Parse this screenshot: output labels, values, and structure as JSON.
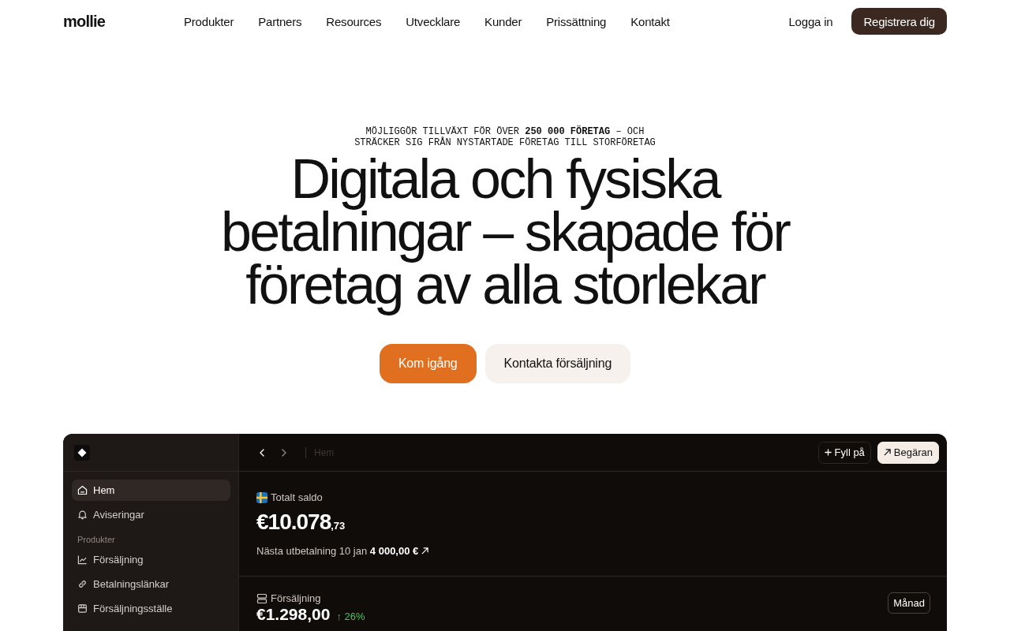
{
  "nav": {
    "logo": "mollie",
    "links": [
      "Produkter",
      "Partners",
      "Resources",
      "Utvecklare",
      "Kunder",
      "Prissättning",
      "Kontakt"
    ],
    "login": "Logga in",
    "signup": "Registrera dig"
  },
  "hero": {
    "eyebrow": "MÖJLIGGÖR TILLVÄXT FÖR ÖVER **250 000 FÖRETAG** – OCH STRÄCKER SIG FRÅN NYSTARTADE FÖRETAG TILL STORFÖRETAG",
    "title": "Digitala och fysiska betalningar – skapade för företag av alla storlekar",
    "buttons": [
      {
        "label": "Kom igång",
        "kind": "primary"
      },
      {
        "label": "Kontakta försäljning",
        "kind": "secondary"
      }
    ]
  },
  "dashboard": {
    "sidebar": {
      "items": [
        {
          "label": "Hem",
          "selected": true
        },
        {
          "label": "Aviseringar",
          "selected": false
        }
      ],
      "sections": [
        {
          "title": "Produkter",
          "items": [
            {
              "label": "Försäljning",
              "selected": false
            },
            {
              "label": "Betalningslänkar",
              "selected": false
            },
            {
              "label": "Försäljningsställe",
              "selected": false
            }
          ]
        }
      ]
    },
    "toolbar": {
      "back_button": {
        "disabled": false
      },
      "forward_button": {
        "disabled": true
      },
      "breadcrumb": "Hem",
      "buttons": [
        {
          "label": "Fyll på",
          "kind": "secondary"
        },
        {
          "label": "Begäran",
          "kind": "primary"
        }
      ]
    },
    "balance": {
      "label": "Totalt saldo",
      "amount": "€10.078",
      "cents": ",73",
      "payout": "Nästa utbetalning 10 jan **4 000,00 €**"
    },
    "sales": {
      "label": "Försäljning",
      "amount": "€1.298,00",
      "change": "↑ 26%",
      "period": "Månad"
    }
  }
}
